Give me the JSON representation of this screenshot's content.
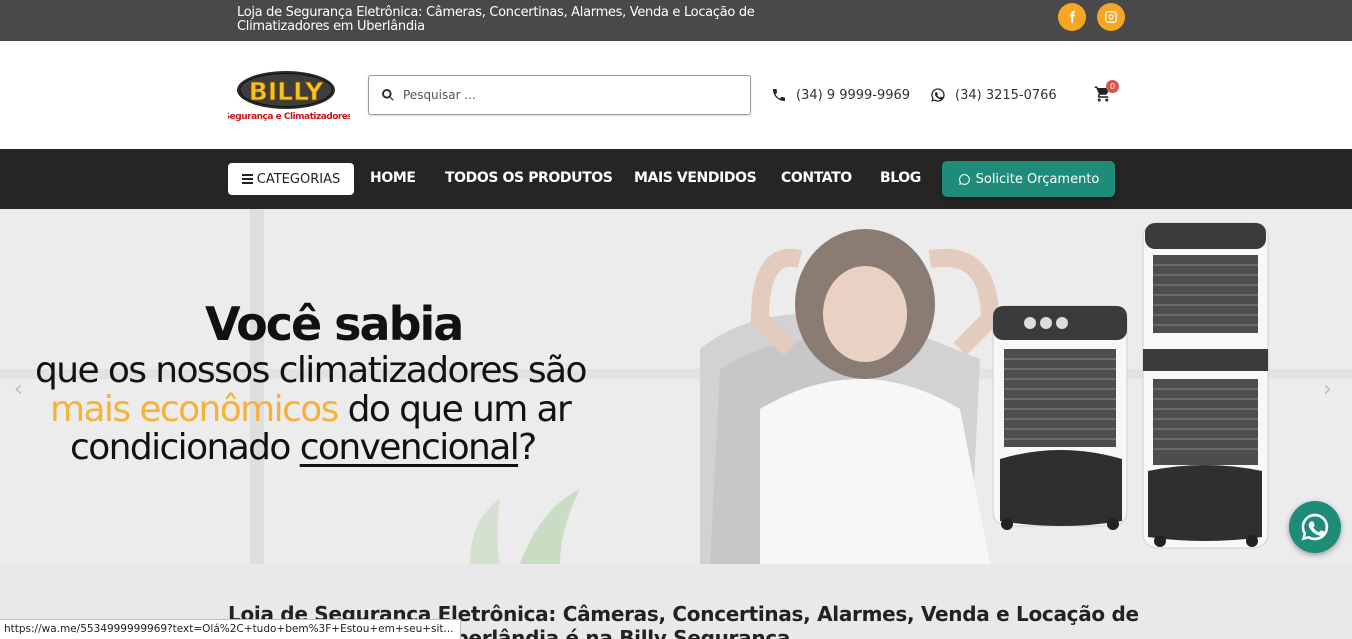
{
  "topbar": {
    "tagline": "Loja de Segurança Eletrônica: Câmeras, Concertinas, Alarmes, Venda e Locação de Climatizadores em Uberlândia",
    "social": [
      {
        "name": "facebook-icon"
      },
      {
        "name": "instagram-icon"
      }
    ]
  },
  "header": {
    "logo": {
      "brand": "BILLY",
      "tagline": "Segurança e Climatizadores"
    },
    "search": {
      "placeholder": "Pesquisar ..."
    },
    "phone": "(34) 9 9999-9969",
    "whatsapp": "(34) 3215-0766",
    "cart_count": "0"
  },
  "nav": {
    "categories_label": "CATEGORIAS",
    "links": [
      "HOME",
      "TODOS OS PRODUTOS",
      "MAIS VENDIDOS",
      "CONTATO",
      "BLOG"
    ],
    "quote_label": "Solicite Orçamento"
  },
  "hero": {
    "line1": "Você sabia",
    "line2": "que os nossos climatizadores são",
    "line3_accent": "mais econômicos",
    "line3_rest": " do que um ar",
    "line4_start": "condicionado ",
    "line4_underline": "convencional",
    "line4_end": "?",
    "prev_arrow": "‹",
    "next_arrow": "›"
  },
  "section": {
    "title": "Loja de Segurança Eletrônica: Câmeras, Concertinas, Alarmes, Venda e Locação de Climatizadores em Uberlândia é na Billy Segurança"
  },
  "status_url": "https://wa.me/5534999999969?text=Olá%2C+tudo+bem%3F+Estou+em+seu+sit...",
  "colors": {
    "accent": "#f6b13a",
    "nav_bg": "#272424",
    "topbar_bg": "#4a4949",
    "quote_btn": "#1e8c79"
  }
}
